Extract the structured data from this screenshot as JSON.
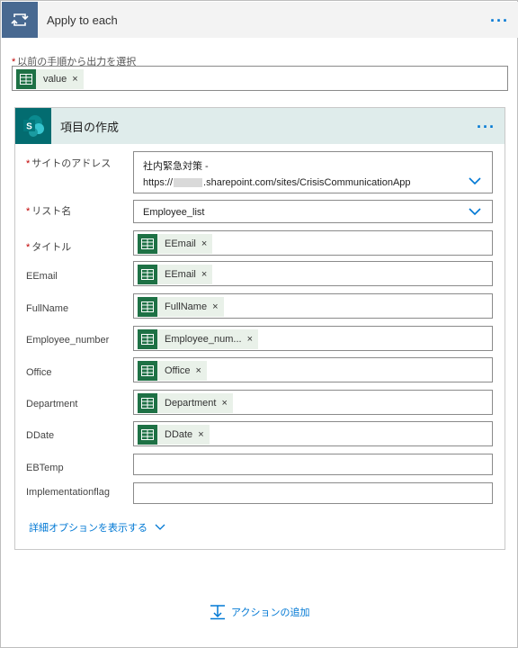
{
  "apply_each": {
    "title": "Apply to each",
    "more": "···"
  },
  "select_output": {
    "label": "以前の手順から出力を選択",
    "token": {
      "text": "value",
      "close": "×"
    }
  },
  "card": {
    "title": "項目の作成",
    "more": "···",
    "site": {
      "label": "サイトのアドレス",
      "line1": "社内緊急対策 -",
      "line2_prefix": "https://",
      "line2_suffix": ".sharepoint.com/sites/CrisisCommunicationApp"
    },
    "list": {
      "label": "リスト名",
      "value": "Employee_list"
    },
    "fields": [
      {
        "label": "タイトル",
        "required": true,
        "token": "EEmail"
      },
      {
        "label": "EEmail",
        "required": false,
        "token": "EEmail"
      },
      {
        "label": "FullName",
        "required": false,
        "token": "FullName"
      },
      {
        "label": "Employee_number",
        "required": false,
        "token": "Employee_num..."
      },
      {
        "label": "Office",
        "required": false,
        "token": "Office"
      },
      {
        "label": "Department",
        "required": false,
        "token": "Department"
      },
      {
        "label": "DDate",
        "required": false,
        "token": "DDate"
      },
      {
        "label": "EBTemp",
        "required": false,
        "token": ""
      },
      {
        "label": "Implementationflag",
        "required": false,
        "token": ""
      }
    ],
    "token_close": "×",
    "advanced": "詳細オプションを表示する"
  },
  "add_action": "アクションの追加",
  "colors": {
    "apply_icon": "#486991",
    "sharepoint": "#036c70",
    "excel": "#1e7145",
    "link": "#0078d4",
    "required": "#c00000"
  },
  "icons": [
    "loop-icon",
    "excel-icon",
    "sharepoint-icon",
    "chevron-down-icon",
    "add-action-icon"
  ]
}
